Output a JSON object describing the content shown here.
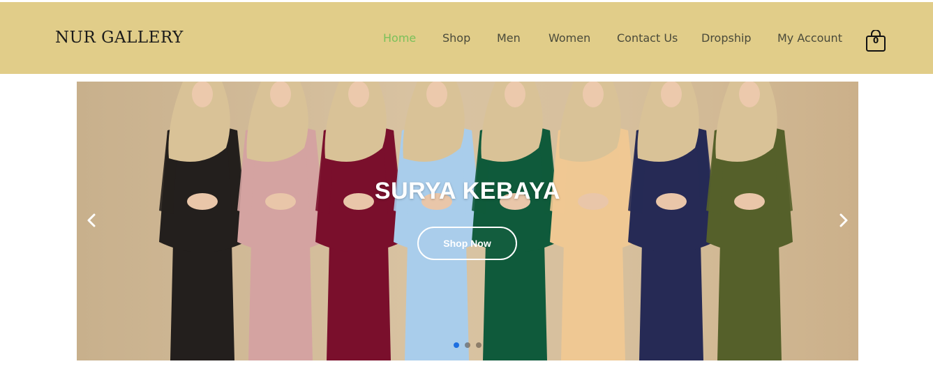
{
  "header": {
    "logo": "NUR GALLERY",
    "background_color": "#e1cd89",
    "active_color": "#7ac05a",
    "nav": [
      {
        "label": "Home",
        "active": true
      },
      {
        "label": "Shop",
        "active": false
      },
      {
        "label": "Men",
        "active": false
      },
      {
        "label": "Women",
        "active": false
      },
      {
        "label": "Contact Us",
        "active": false
      },
      {
        "label": "Dropship",
        "active": false
      },
      {
        "label": "My Account",
        "active": false
      }
    ],
    "cart": {
      "icon": "shopping-bag-icon",
      "count": "0"
    }
  },
  "hero": {
    "title": "SURYA KEBAYA",
    "button_label": "Shop Now",
    "prev_icon": "chevron-left-icon",
    "next_icon": "chevron-right-icon",
    "slide_count": 3,
    "active_slide": 1,
    "dot_active_color": "#1e6fe0",
    "models": [
      {
        "icon": "model-figure",
        "outfit_color": "#231f1d",
        "hijab_color": "#d9c297"
      },
      {
        "icon": "model-figure",
        "outfit_color": "#d4a3a1",
        "hijab_color": "#d9c297"
      },
      {
        "icon": "model-figure",
        "outfit_color": "#7a0f2c",
        "hijab_color": "#d9c297"
      },
      {
        "icon": "model-figure",
        "outfit_color": "#a9cdeb",
        "hijab_color": "#d9c297"
      },
      {
        "icon": "model-figure",
        "outfit_color": "#0f5a3b",
        "hijab_color": "#d9c297"
      },
      {
        "icon": "model-figure",
        "outfit_color": "#efc893",
        "hijab_color": "#d9c297"
      },
      {
        "icon": "model-figure",
        "outfit_color": "#262a55",
        "hijab_color": "#d9c297"
      },
      {
        "icon": "model-figure",
        "outfit_color": "#55602a",
        "hijab_color": "#d9c297"
      }
    ]
  }
}
